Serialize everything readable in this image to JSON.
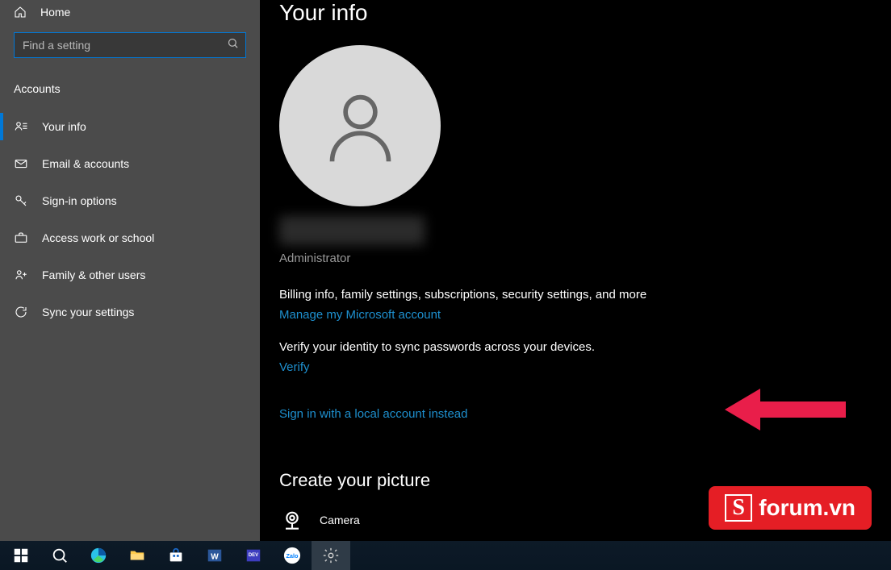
{
  "sidebar": {
    "home": "Home",
    "search_placeholder": "Find a setting",
    "category": "Accounts",
    "items": [
      {
        "id": "your-info",
        "label": "Your info",
        "selected": true
      },
      {
        "id": "email",
        "label": "Email & accounts",
        "selected": false
      },
      {
        "id": "signin",
        "label": "Sign-in options",
        "selected": false
      },
      {
        "id": "work",
        "label": "Access work or school",
        "selected": false
      },
      {
        "id": "family",
        "label": "Family & other users",
        "selected": false
      },
      {
        "id": "sync",
        "label": "Sync your settings",
        "selected": false
      }
    ]
  },
  "content": {
    "title": "Your info",
    "role": "Administrator",
    "billing_text": "Billing info, family settings, subscriptions, security settings, and more",
    "manage_link": "Manage my Microsoft account",
    "verify_text": "Verify your identity to sync passwords across your devices.",
    "verify_link": "Verify",
    "local_account_link": "Sign in with a local account instead",
    "create_picture_title": "Create your picture",
    "camera_label": "Camera"
  },
  "watermark": {
    "text": "forum.vn"
  },
  "colors": {
    "accent": "#0078d7",
    "link": "#1e90cf",
    "arrow": "#e91e4a"
  }
}
